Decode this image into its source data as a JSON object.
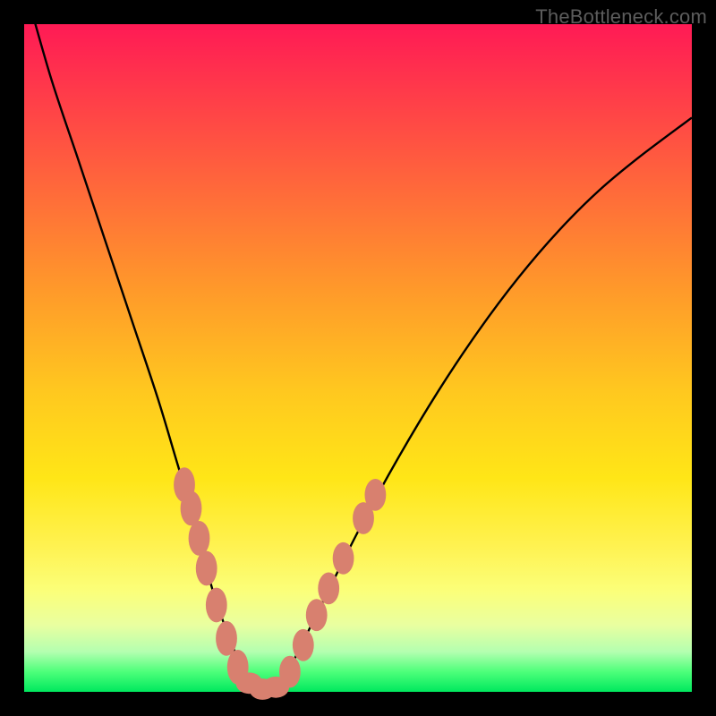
{
  "watermark": "TheBottleneck.com",
  "colors": {
    "frame": "#000000",
    "curve": "#000000",
    "marker": "#d8806f"
  },
  "chart_data": {
    "type": "line",
    "title": "",
    "xlabel": "",
    "ylabel": "",
    "xlim": [
      0,
      100
    ],
    "ylim": [
      0,
      100
    ],
    "annotations": [
      "TheBottleneck.com"
    ],
    "series": [
      {
        "name": "bottleneck-curve",
        "x": [
          0,
          4,
          8,
          12,
          16,
          20,
          23,
          26,
          28,
          30,
          32,
          34,
          36,
          38,
          40,
          44,
          50,
          56,
          62,
          68,
          74,
          80,
          86,
          92,
          100
        ],
        "y": [
          106,
          92,
          80,
          68,
          56,
          44,
          34,
          24,
          16,
          10,
          5,
          1,
          0,
          1,
          4,
          12,
          24,
          35,
          45,
          54,
          62,
          69,
          75,
          80,
          86
        ]
      }
    ],
    "markers": [
      {
        "x": 24.0,
        "y": 31.0,
        "rx": 1.6,
        "ry": 2.6
      },
      {
        "x": 25.0,
        "y": 27.5,
        "rx": 1.6,
        "ry": 2.6
      },
      {
        "x": 26.2,
        "y": 23.0,
        "rx": 1.6,
        "ry": 2.6
      },
      {
        "x": 27.3,
        "y": 18.5,
        "rx": 1.6,
        "ry": 2.6
      },
      {
        "x": 28.8,
        "y": 13.0,
        "rx": 1.6,
        "ry": 2.6
      },
      {
        "x": 30.3,
        "y": 8.0,
        "rx": 1.6,
        "ry": 2.6
      },
      {
        "x": 32.0,
        "y": 3.7,
        "rx": 1.6,
        "ry": 2.6
      },
      {
        "x": 33.7,
        "y": 1.3,
        "rx": 2.0,
        "ry": 1.6
      },
      {
        "x": 35.7,
        "y": 0.4,
        "rx": 2.0,
        "ry": 1.6
      },
      {
        "x": 37.7,
        "y": 0.7,
        "rx": 2.0,
        "ry": 1.6
      },
      {
        "x": 39.8,
        "y": 3.0,
        "rx": 1.6,
        "ry": 2.4
      },
      {
        "x": 41.8,
        "y": 7.0,
        "rx": 1.6,
        "ry": 2.4
      },
      {
        "x": 43.8,
        "y": 11.5,
        "rx": 1.6,
        "ry": 2.4
      },
      {
        "x": 45.6,
        "y": 15.5,
        "rx": 1.6,
        "ry": 2.4
      },
      {
        "x": 47.8,
        "y": 20.0,
        "rx": 1.6,
        "ry": 2.4
      },
      {
        "x": 50.8,
        "y": 26.0,
        "rx": 1.6,
        "ry": 2.4
      },
      {
        "x": 52.6,
        "y": 29.5,
        "rx": 1.6,
        "ry": 2.4
      }
    ]
  }
}
